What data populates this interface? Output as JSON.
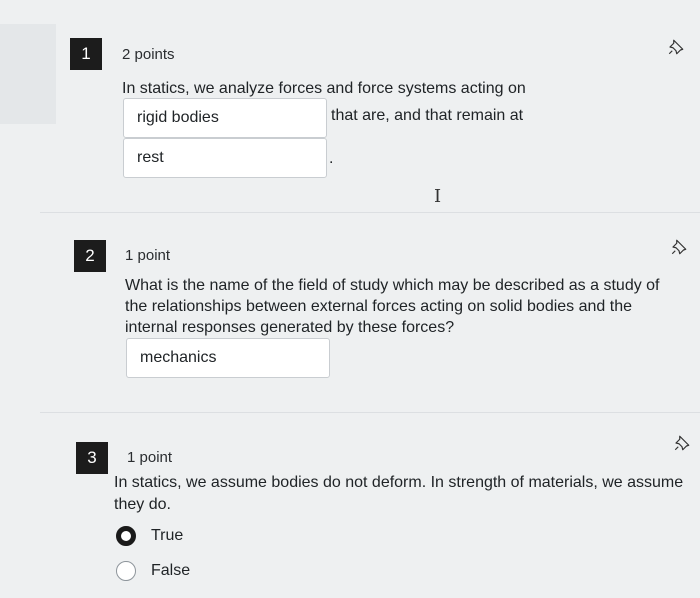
{
  "questions": [
    {
      "number": "1",
      "points": "2 points",
      "text_before": "In statics, we analyze forces and force systems acting on",
      "blank1_value": "rigid bodies",
      "text_middle": "that are, and that remain at",
      "blank2_value": "rest",
      "text_after": "."
    },
    {
      "number": "2",
      "points": "1 point",
      "text_line1": "What is the name of the field of study which may be described as a study of",
      "text_line2": "the relationships between external forces acting on solid bodies and the",
      "text_line3": "internal responses generated by these forces?",
      "answer_value": "mechanics"
    },
    {
      "number": "3",
      "points": "1 point",
      "text_line1": "In statics, we assume bodies do not deform. In strength of materials, we assume",
      "text_line2": "they do.",
      "options": [
        {
          "label": "True",
          "selected": true
        },
        {
          "label": "False",
          "selected": false
        }
      ]
    }
  ],
  "cursor_glyph": "I",
  "icons": {
    "pin": "pin-icon"
  }
}
